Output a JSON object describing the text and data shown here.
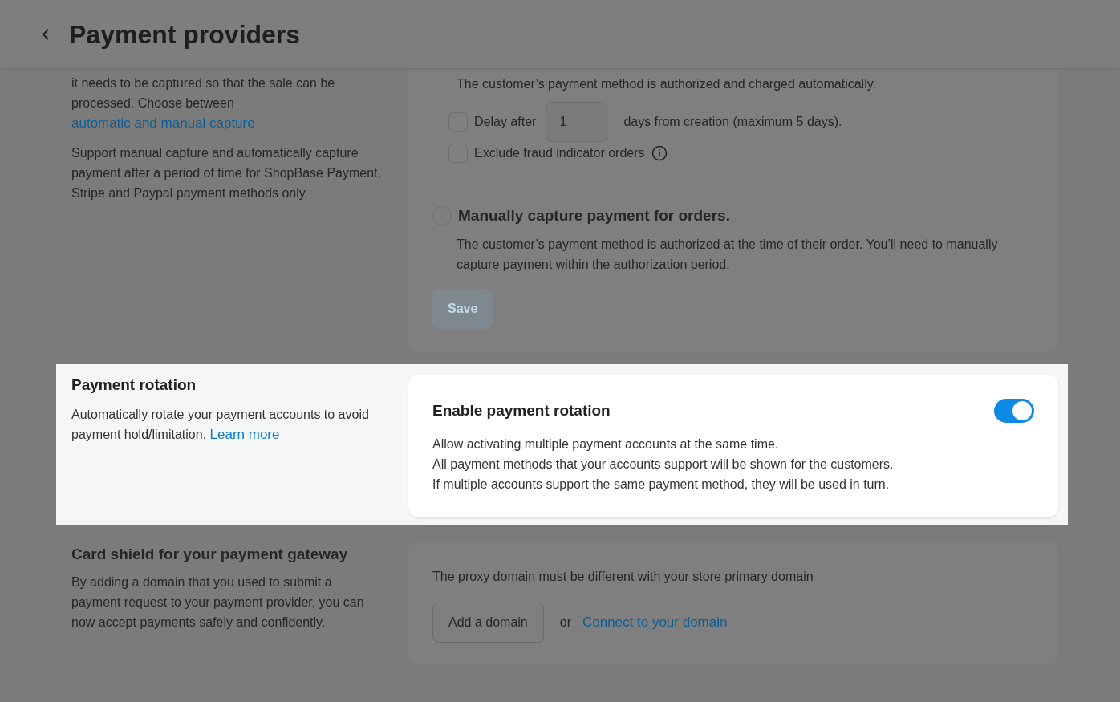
{
  "header": {
    "title": "Payment providers"
  },
  "capture": {
    "intro": "it needs to be captured so that the sale can be processed. Choose between",
    "intro_link": "automatic and manual capture",
    "note": "Support manual capture and automatically capture payment after a period of time for ShopBase Payment, Stripe and Paypal payment methods only.",
    "auto_description": "The customer’s payment method is authorized and charged automatically.",
    "delay": {
      "label": "Delay after",
      "value": "1",
      "suffix": "days from creation (maximum 5 days).",
      "checked": false
    },
    "fraud": {
      "label": "Exclude fraud indicator orders",
      "checked": false
    },
    "manual": {
      "title": "Manually capture payment for orders.",
      "description": "The customer’s payment method is authorized at the time of their order. You’ll need to manually capture payment within the authorization period.",
      "selected": false
    },
    "save": {
      "label": "Save",
      "disabled": true
    }
  },
  "rotation": {
    "title": "Payment rotation",
    "description": "Automatically rotate your payment accounts to avoid payment hold/limitation.",
    "link": "Learn more",
    "card_title": "Enable payment rotation",
    "on": true,
    "lines": [
      "Allow activating multiple payment accounts at the same time.",
      "All payment methods that your accounts support will be shown for the customers.",
      "If multiple accounts support the same payment method, they will be used in turn."
    ]
  },
  "card_shield": {
    "title": "Card shield for your payment gateway",
    "description": "By adding a domain that you used to submit a payment request to your payment provider, you can now accept payments safely and confidently.",
    "note": "The proxy domain must be different with your store primary domain",
    "add_button": "Add a domain",
    "or": "or",
    "link": "Connect to your domain"
  }
}
